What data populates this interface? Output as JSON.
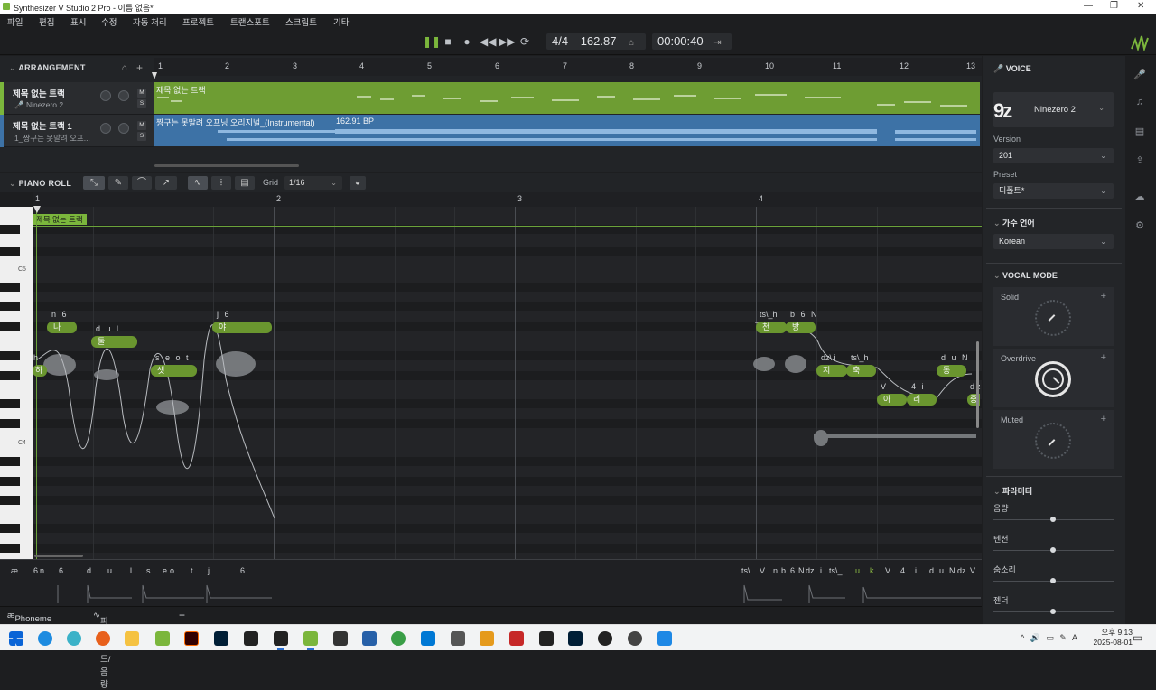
{
  "window": {
    "title": "Synthesizer V Studio 2 Pro - 이름 없음*"
  },
  "menu": [
    "파일",
    "편집",
    "표시",
    "수정",
    "자동 처리",
    "프로젝트",
    "트랜스포트",
    "스크립트",
    "기타"
  ],
  "transport": {
    "time_signature": "4/4",
    "tempo": "162.87",
    "time": "00:00:40"
  },
  "arrangement": {
    "title": "ARRANGEMENT",
    "ruler": [
      "1",
      "2",
      "3",
      "4",
      "5",
      "6",
      "7",
      "8",
      "9",
      "10",
      "11",
      "12",
      "13"
    ],
    "tracks": [
      {
        "name": "제목 없는 트랙",
        "sub": "Ninezero 2",
        "clip": "제목 없는 트랙",
        "color": "#6e9d33"
      },
      {
        "name": "제목 없는 트랙 1",
        "sub": "1_짱구는 못말려 오프...",
        "clip": "짱구는 못말려 오프닝 오리지널_(Instrumental)",
        "bpm": "162.91 BP",
        "color": "#3d72a6"
      }
    ],
    "mute_label": "M",
    "solo_label": "S"
  },
  "piano_roll": {
    "title": "PIANO ROLL",
    "grid_label": "Grid",
    "grid_value": "1/16",
    "ruler": [
      "1",
      "2",
      "3",
      "4"
    ],
    "track_tag": "제목 없는 트랙",
    "key_labels": [
      "C5",
      "C4"
    ],
    "notes": [
      {
        "lyric": "하",
        "ph": "h"
      },
      {
        "lyric": "나",
        "ph": "n 6"
      },
      {
        "lyric": "둘",
        "ph": "d u l"
      },
      {
        "lyric": "셋",
        "ph": "s e o t"
      },
      {
        "lyric": "야",
        "ph": "j 6"
      },
      {
        "lyric": "천",
        "ph": "ts\\_h"
      },
      {
        "lyric": "방",
        "ph": "b 6 N"
      },
      {
        "lyric": "지",
        "ph": "dz\\ i"
      },
      {
        "lyric": "축",
        "ph": "ts\\_h"
      },
      {
        "lyric": "아",
        "ph": "V"
      },
      {
        "lyric": "리",
        "ph": "4 i"
      },
      {
        "lyric": "동",
        "ph": "d u N"
      },
      {
        "lyric": "중",
        "ph": "dz"
      }
    ]
  },
  "phoneme_track": {
    "symbol": "æ",
    "left": [
      "6",
      "n",
      "6",
      "d",
      "u",
      "l",
      "s",
      "e",
      "o",
      "t",
      "j",
      "6"
    ],
    "right": [
      "ts\\",
      "V",
      "n",
      "b",
      "6",
      "N",
      "dz",
      "i",
      "ts\\_",
      "u",
      "k",
      "V",
      "4",
      "i",
      "d",
      "u",
      "N",
      "dz",
      "V"
    ]
  },
  "bottom_tabs": {
    "tab1": "Phoneme Timing",
    "tab2": "피치밴드/음량",
    "add": "+"
  },
  "voice_panel": {
    "title": "VOICE",
    "voice_name": "Ninezero 2",
    "avatar": "9z",
    "version_label": "Version",
    "version": "201",
    "preset_label": "Preset",
    "preset": "디폴트*",
    "language_section": "가수 언어",
    "language": "Korean",
    "vocal_mode_section": "VOCAL MODE",
    "modes": [
      "Solid",
      "Overdrive",
      "Muted"
    ],
    "params_section": "파라미터",
    "params": [
      {
        "name": "음량",
        "value": 0.5
      },
      {
        "name": "텐션",
        "value": 0.5
      },
      {
        "name": "숨소리",
        "value": 0.5
      },
      {
        "name": "젠더",
        "value": 0.5
      }
    ]
  },
  "taskbar": {
    "clock_time": "오후 9:13",
    "clock_date": "2025-08-01",
    "lang": "A"
  },
  "colors": {
    "accent": "#7bb63c",
    "audio": "#3d72a6"
  }
}
